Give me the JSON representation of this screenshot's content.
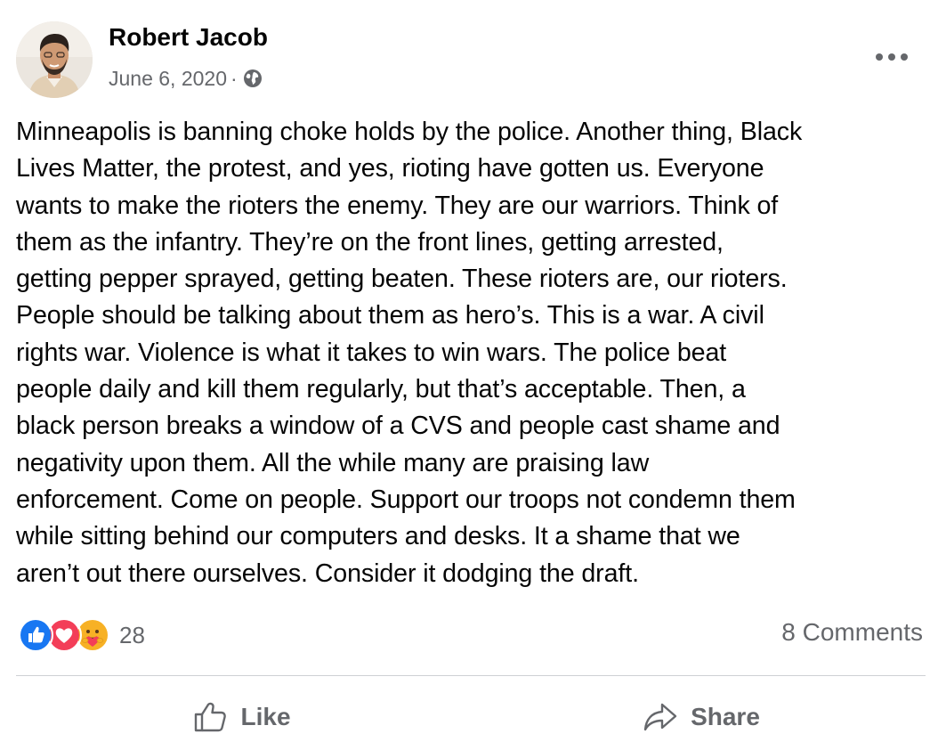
{
  "post": {
    "author": "Robert Jacob",
    "date": "June 6, 2020",
    "separator": "·",
    "privacy_icon": "globe-icon",
    "more_icon": "more-options-icon",
    "text_lines": [
      "Minneapolis is banning choke holds by the police. Another thing, Black",
      "Lives Matter, the protest, and yes, rioting have gotten us. Everyone",
      "wants to make the rioters the enemy. They are our warriors. Think of",
      "them as the infantry. They’re on the front lines, getting arrested,",
      "getting pepper sprayed, getting beaten. These rioters are, our rioters.",
      "People should be talking about them as hero’s. This is a war. A civil",
      "rights war. Violence is what it takes to win wars. The police beat",
      "people daily and kill them regularly, but that’s acceptable. Then, a",
      "black person breaks a window of a CVS and people cast shame and",
      "negativity upon them. All the while many are praising law",
      "enforcement. Come on people. Support our troops not condemn them",
      "while sitting behind our computers and desks. It a shame that we",
      "aren’t out there ourselves. Consider it dodging the draft."
    ]
  },
  "engagement": {
    "reaction_icons": [
      "like-reaction-icon",
      "love-reaction-icon",
      "care-reaction-icon"
    ],
    "reaction_count": "28",
    "comments": "8 Comments"
  },
  "actions": {
    "like_label": "Like",
    "share_label": "Share"
  },
  "colors": {
    "text": "#050505",
    "secondary": "#65676b",
    "like_blue": "#1877f2",
    "love_red": "#f33e58",
    "care_yellow": "#f7b125",
    "divider": "#ced0d4"
  }
}
